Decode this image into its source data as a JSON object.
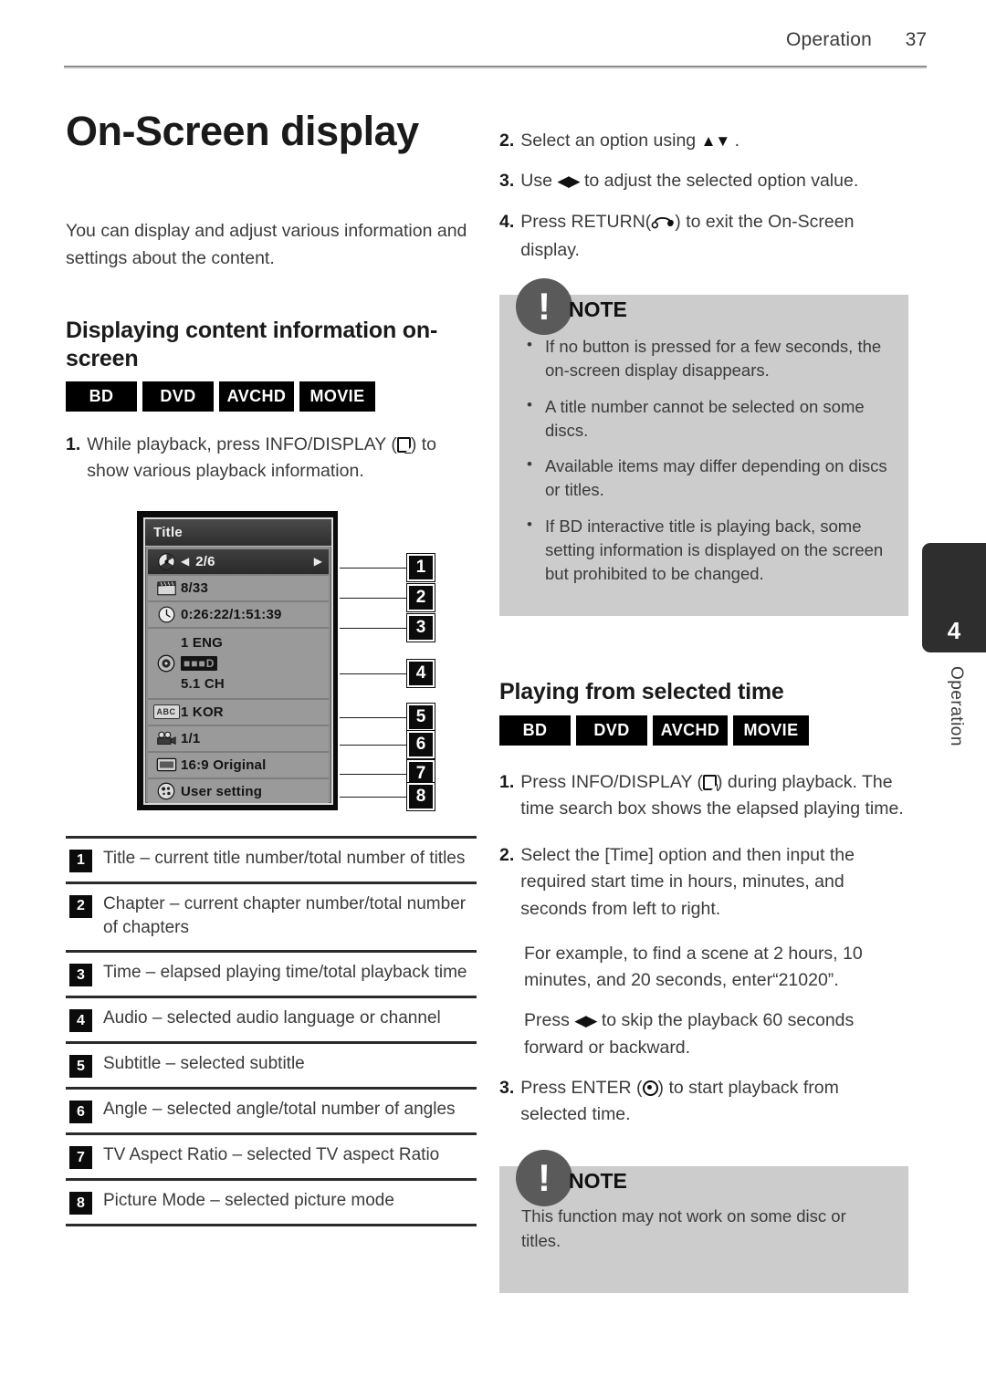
{
  "header": {
    "section": "Operation",
    "page_number": "37"
  },
  "side_tab": {
    "chapter_number": "4",
    "chapter_label": "Operation"
  },
  "left": {
    "title": "On-Screen display",
    "intro": "You can display and adjust various information and settings about the content.",
    "subheading": "Displaying content information on-screen",
    "badges": [
      "BD",
      "DVD",
      "AVCHD",
      "MOVIE"
    ],
    "step1_no": "1.",
    "step1_a": "While playback, press INFO/DISPLAY (",
    "step1_b": ") to show various playback information."
  },
  "osd": {
    "window_title": "Title",
    "rows": [
      {
        "icon": "disc-icon",
        "value": "2/6",
        "arrow_left": "◀",
        "arrow_right": "▶"
      },
      {
        "icon": "clapperboard-icon",
        "value": "8/33"
      },
      {
        "icon": "clock-icon",
        "value": "0:26:22/1:51:39"
      },
      {
        "icon": "audio-icon",
        "value_line1": "1 ENG",
        "value_line2": "DOLBY DIGITAL",
        "value_line3": "5.1 CH"
      },
      {
        "icon": "subtitle-abc-icon",
        "value": "1 KOR"
      },
      {
        "icon": "camera-angle-icon",
        "value": "1/1"
      },
      {
        "icon": "tv-aspect-icon",
        "value": "16:9 Original"
      },
      {
        "icon": "picture-mode-icon",
        "value": "User setting"
      }
    ],
    "callouts": [
      "1",
      "2",
      "3",
      "4",
      "5",
      "6",
      "7",
      "8"
    ]
  },
  "legend": [
    {
      "no": "1",
      "text": "Title – current title number/total number of titles"
    },
    {
      "no": "2",
      "text": "Chapter – current chapter number/total number of chapters"
    },
    {
      "no": "3",
      "text": "Time – elapsed playing time/total playback time"
    },
    {
      "no": "4",
      "text": "Audio – selected audio language or channel"
    },
    {
      "no": "5",
      "text": "Subtitle – selected subtitle"
    },
    {
      "no": "6",
      "text": "Angle – selected angle/total number of angles"
    },
    {
      "no": "7",
      "text": "TV Aspect Ratio – selected TV aspect Ratio"
    },
    {
      "no": "8",
      "text": "Picture Mode – selected picture mode"
    }
  ],
  "right": {
    "step2_no": "2.",
    "step2_a": "Select an option using ",
    "step2_arrows": "▲▼",
    "step2_b": " .",
    "step3_no": "3.",
    "step3_a": "Use ",
    "step3_arrows": "◀▶",
    "step3_b": " to adjust the selected option value.",
    "step4_no": "4.",
    "step4_a": "Press RETURN(",
    "step4_b": ") to exit the On-Screen display.",
    "note1_label": "NOTE",
    "note1_items": [
      "If no button is pressed for a few seconds, the on-screen display disappears.",
      "A title number cannot be selected on some discs.",
      "Available items may differ depending on discs or titles.",
      "If BD interactive title is playing back, some setting information is displayed on the screen but prohibited to be changed."
    ],
    "heading2": "Playing from selected time",
    "badges2": [
      "BD",
      "DVD",
      "AVCHD",
      "MOVIE"
    ],
    "t_step1_no": "1.",
    "t_step1_a": "Press INFO/DISPLAY (",
    "t_step1_b": ") during playback. The time search box shows the elapsed playing time.",
    "t_step2_no": "2.",
    "t_step2_text": "Select the [Time] option and then input the required start time in hours, minutes, and seconds from left to right.",
    "t_step2_example": "For example, to find a scene at 2 hours, 10 minutes, and 20 seconds, enter“21020”.",
    "t_step2_press_a": "Press ",
    "t_step2_press_arrows": "◀▶",
    "t_step2_press_b": " to skip the playback 60 seconds forward or backward.",
    "t_step3_no": "3.",
    "t_step3_a": "Press ENTER (",
    "t_step3_b": ") to start playback from selected time.",
    "note2_label": "NOTE",
    "note2_text": "This function may not work on some disc or titles."
  },
  "colors": {
    "note_bg": "#cccccc",
    "badge_bg": "#000000",
    "tab_bg": "#2e2e2e",
    "rule": "#2b2b2b"
  }
}
